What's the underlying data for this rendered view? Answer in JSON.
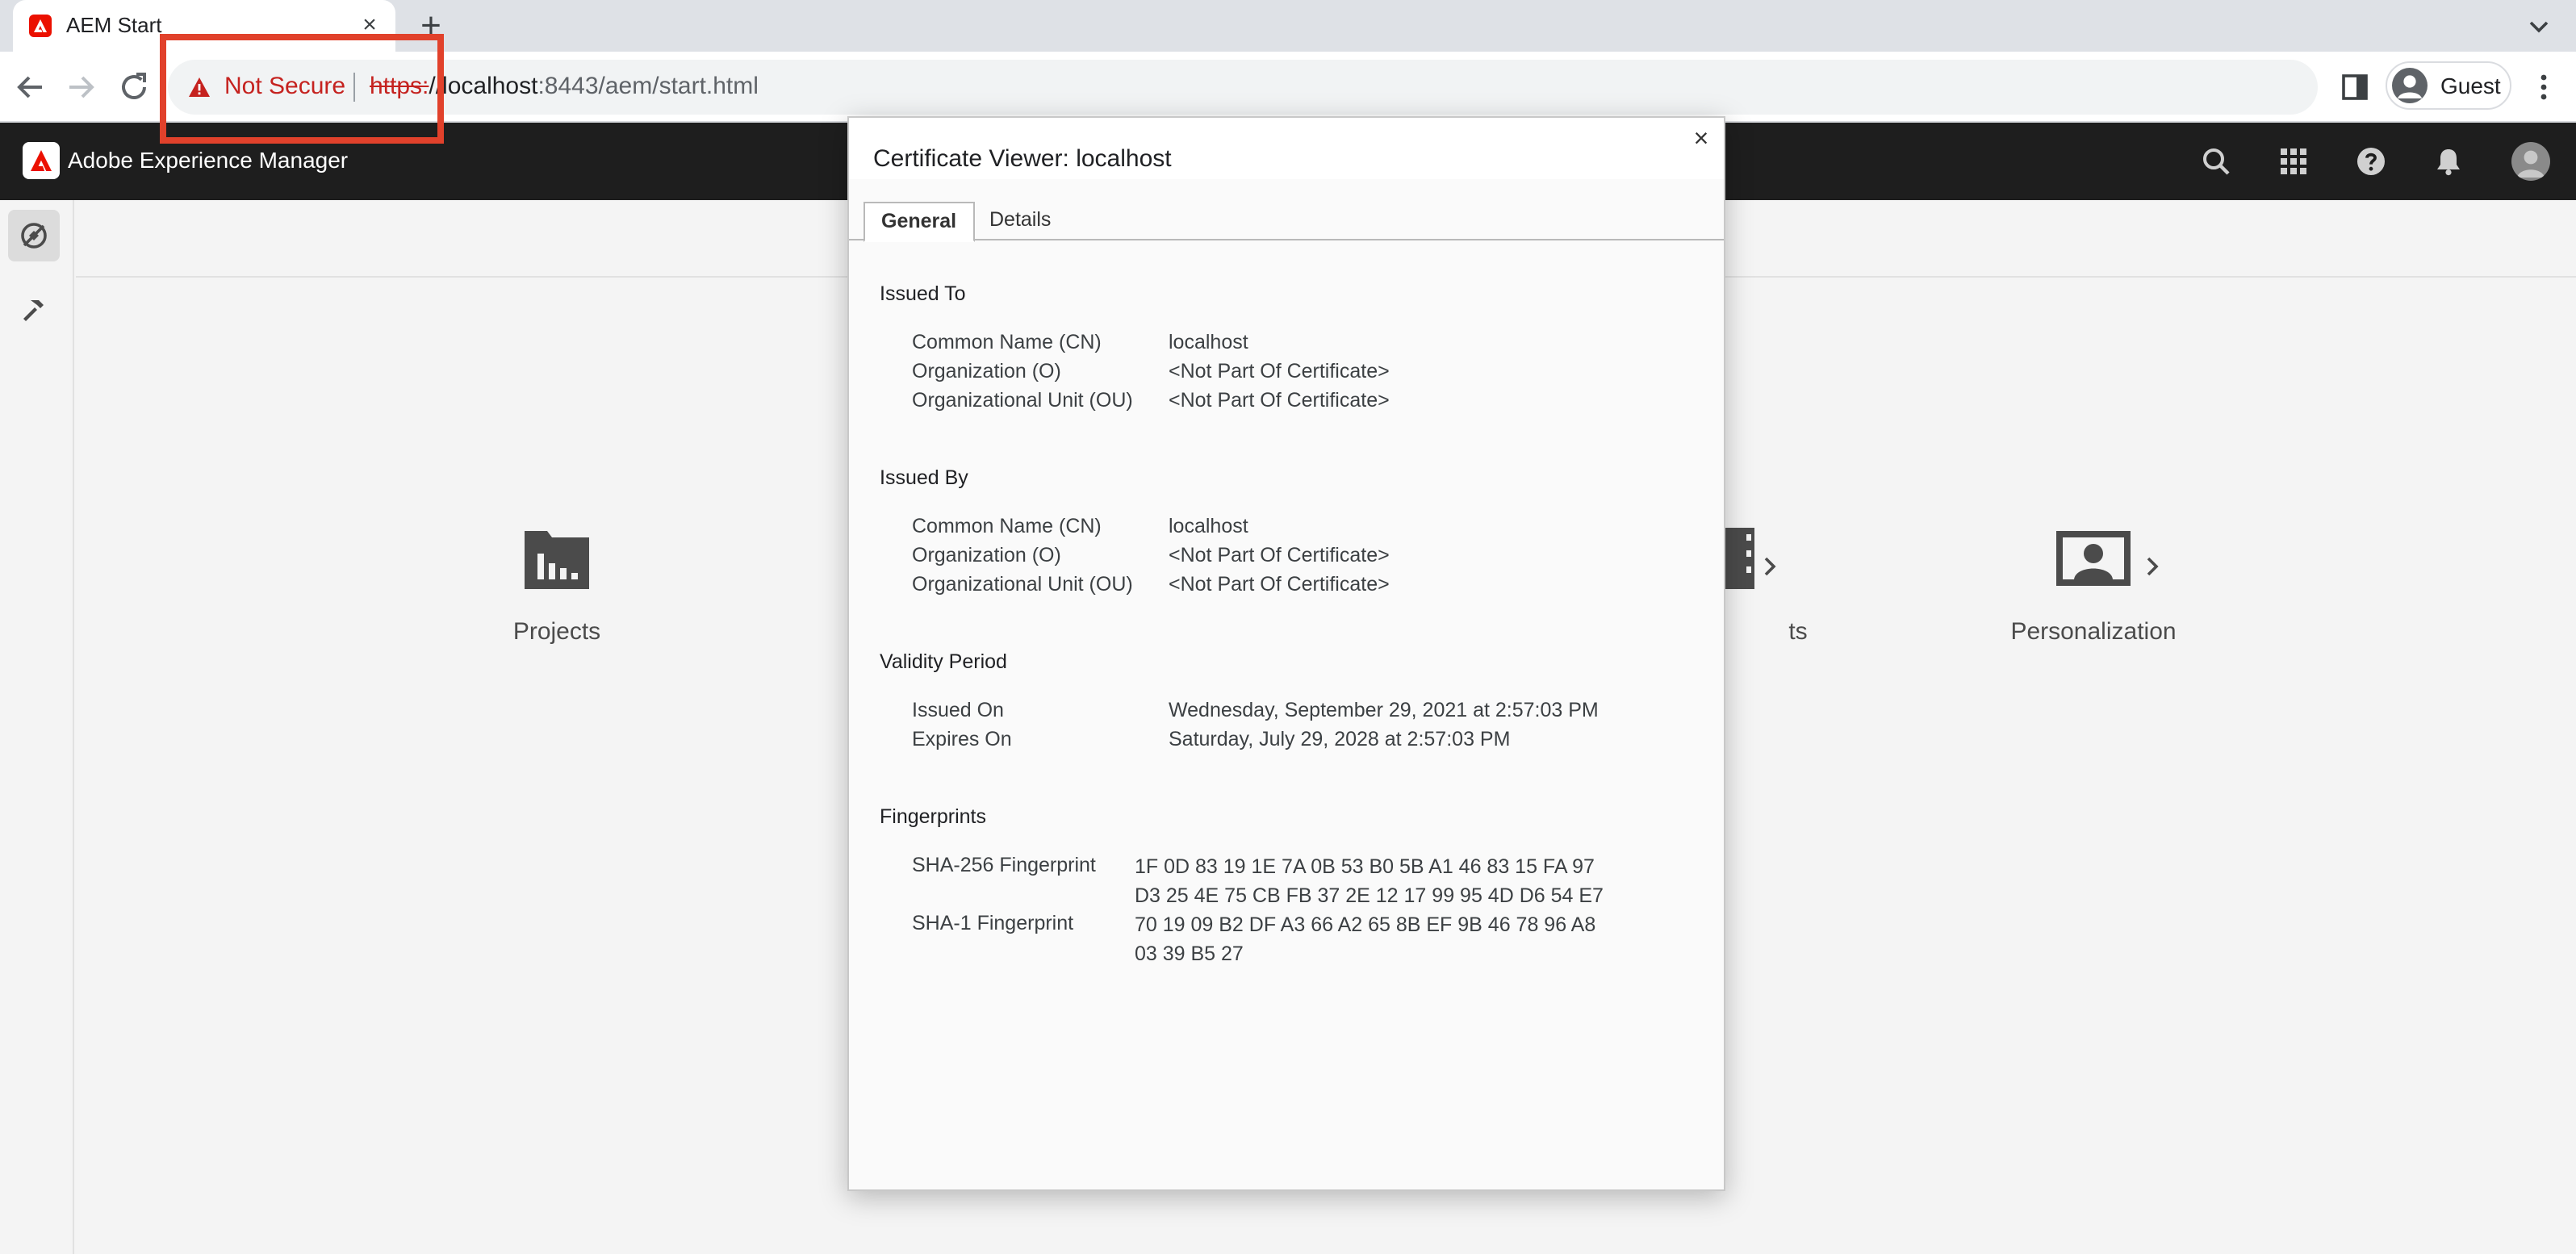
{
  "browser": {
    "tab_title": "AEM Start",
    "tab_close": "×",
    "new_tab": "+",
    "security_label": "Not Secure",
    "url_scheme": "https:",
    "url_host": "//localhost",
    "url_rest": ":8443/aem/start.html",
    "profile_label": "Guest"
  },
  "aem": {
    "app_title": "Adobe Experience Manager",
    "tiles": [
      {
        "label": "Projects",
        "icon": "projects-icon"
      },
      {
        "label": "ts",
        "icon": "assets-icon"
      },
      {
        "label": "Personalization",
        "icon": "personalization-icon"
      }
    ]
  },
  "cert": {
    "title": "Certificate Viewer: localhost",
    "close": "×",
    "tabs": [
      "General",
      "Details"
    ],
    "issued_to": {
      "heading": "Issued To",
      "rows": [
        {
          "label": "Common Name (CN)",
          "value": "localhost"
        },
        {
          "label": "Organization (O)",
          "value": "<Not Part Of Certificate>"
        },
        {
          "label": "Organizational Unit (OU)",
          "value": "<Not Part Of Certificate>"
        }
      ]
    },
    "issued_by": {
      "heading": "Issued By",
      "rows": [
        {
          "label": "Common Name (CN)",
          "value": "localhost"
        },
        {
          "label": "Organization (O)",
          "value": "<Not Part Of Certificate>"
        },
        {
          "label": "Organizational Unit (OU)",
          "value": "<Not Part Of Certificate>"
        }
      ]
    },
    "validity": {
      "heading": "Validity Period",
      "rows": [
        {
          "label": "Issued On",
          "value": "Wednesday, September 29, 2021 at 2:57:03 PM"
        },
        {
          "label": "Expires On",
          "value": "Saturday, July 29, 2028 at 2:57:03 PM"
        }
      ]
    },
    "fingerprints": {
      "heading": "Fingerprints",
      "sha256_label": "SHA-256 Fingerprint",
      "sha256_line1": "1F 0D 83 19 1E 7A 0B 53 B0 5B A1 46 83 15 FA 97",
      "sha256_line2": "D3 25 4E 75 CB FB 37 2E 12 17 99 95 4D D6 54 E7",
      "sha1_label": "SHA-1 Fingerprint",
      "sha1_line1": "70 19 09 B2 DF A3 66 A2 65 8B EF 9B 46 78 96 A8",
      "sha1_line2": "03 39 B5 27"
    }
  },
  "colors": {
    "not_secure_red": "#c5221f",
    "highlight_red": "#e1412b",
    "aem_header": "#1e1e1e",
    "adobe_red": "#eb1000"
  }
}
